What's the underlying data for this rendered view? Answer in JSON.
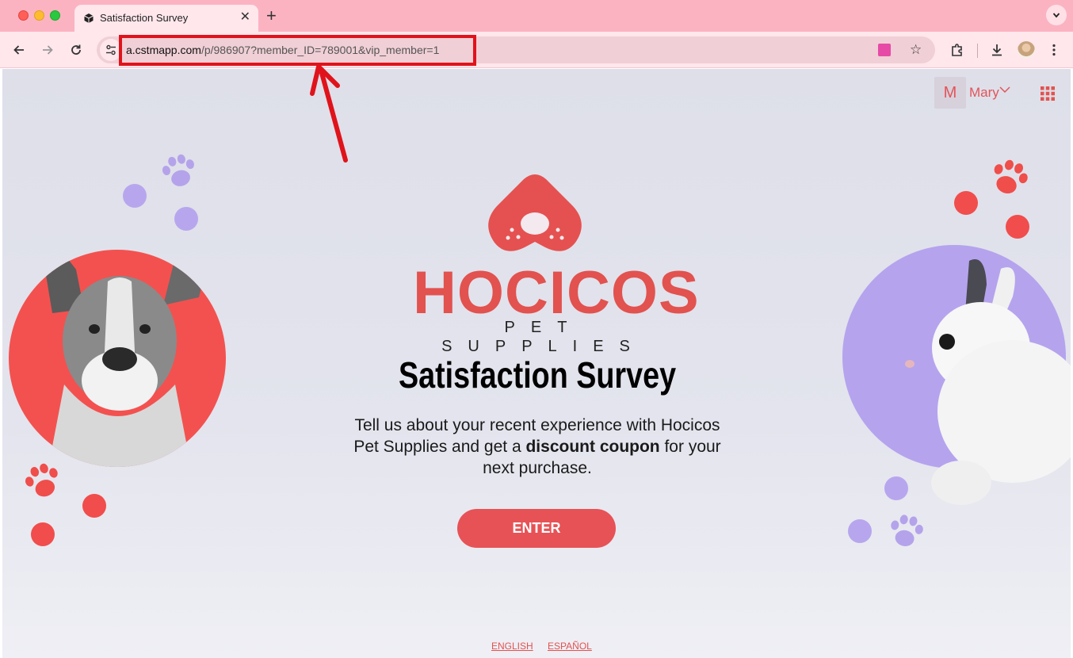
{
  "browser": {
    "tab_title": "Satisfaction Survey",
    "url_host": "a.cstmapp.com",
    "url_path": "/p/986907?member_ID=789001&vip_member=1"
  },
  "page": {
    "user_initial": "M",
    "user_name": "Mary",
    "brand_name": "HOCICOS",
    "brand_tagline": "PET SUPPLIES",
    "title": "Satisfaction Survey",
    "description_part1": "Tell us about your recent experience with Hocicos Pet Supplies and get a ",
    "description_bold": "discount coupon",
    "description_part2": " for your next purchase.",
    "enter_label": "ENTER",
    "languages": [
      "ENGLISH",
      "ESPAÑOL"
    ]
  },
  "icons": {
    "tab_favicon": "cube-icon",
    "back": "arrow-left-icon",
    "forward": "arrow-right-icon",
    "reload": "reload-icon",
    "site_info": "tune-icon",
    "bookmark": "star-icon",
    "extensions": "puzzle-icon",
    "download": "download-icon",
    "menu": "kebab-menu-icon",
    "apps": "grid-icon"
  },
  "colors": {
    "tab_strip": "#fbb3c2",
    "toolbar": "#ffe7ec",
    "brand_red": "#e2524f",
    "button_red": "#e75256",
    "lavender": "#b5a3ee",
    "annotation_red": "#e0131b"
  }
}
